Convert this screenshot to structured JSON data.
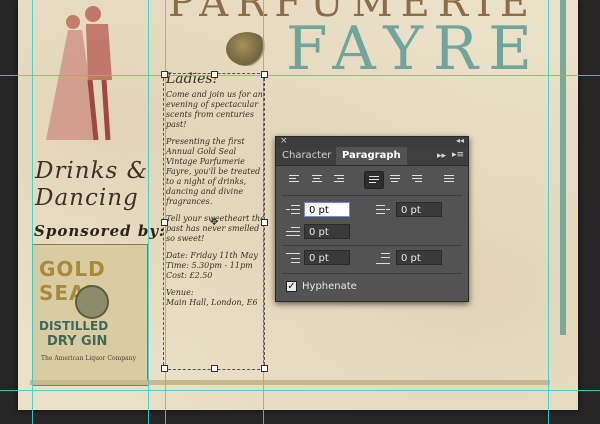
{
  "poster": {
    "title_partial": "FAYRE",
    "title_top_partial": "PARFUMERIE",
    "drinks_line1": "Drinks &",
    "drinks_line2": "Dancing",
    "sponsored_by": "Sponsored by:",
    "label": {
      "brand": "GOLD SEAL",
      "line1": "DISTILLED",
      "line2": "DRY GIN",
      "smallprint": "The American Liquor Company"
    },
    "body": {
      "heading": "Ladies!",
      "p1": "Come and join us for an evening of spectacular scents from centuries past!",
      "p2": "Presenting the first Annual Gold Seal Vintage Parfumerie Fayre, you'll be treated to a night of drinks, dancing and divine fragrances.",
      "p3": "Tell your sweetheart the past has never smelled so sweet!",
      "p4_date": "Date: Friday 11th May",
      "p4_time": "Time: 5.30pm - 11pm",
      "p4_cost": "Cost: £2.50",
      "p5_venue": "Venue:",
      "p5_addr": "Main Hall, London, E6"
    }
  },
  "panel": {
    "close": "×",
    "collapse": "◂◂",
    "tabs": [
      "Character",
      "Paragraph"
    ],
    "tab_icons": "▸▸",
    "menu_icon": "▸≡",
    "left_indent": "0 pt",
    "right_indent": "0 pt",
    "first_line_indent": "0 pt",
    "space_before": "0 pt",
    "space_after": "0 pt",
    "hyphenate_label": "Hyphenate",
    "hyphenate_checked": "✓"
  },
  "colors": {
    "guide": "#39d0cf",
    "panel_bg": "#535353",
    "paper": "#ebe1c9",
    "teal": "#6fa59c"
  }
}
